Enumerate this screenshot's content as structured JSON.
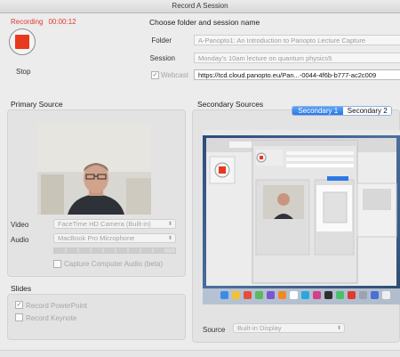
{
  "window": {
    "title": "Record A Session"
  },
  "recording": {
    "status": "Recording",
    "timer": "00:00:12",
    "stop_label": "Stop"
  },
  "session": {
    "heading": "Choose folder and session name",
    "folder_label": "Folder",
    "folder_value": "A-Panopto1: An Introduction to Panopto Lecture Capture",
    "session_label": "Session",
    "session_value": "Monday's 10am lecture on quantum physics5",
    "webcast_label": "Webcast",
    "webcast_url": "https://tcd.cloud.panopto.eu/Pan...-0044-4f6b-b777-ac2c009"
  },
  "primary": {
    "title": "Primary Source",
    "video_label": "Video",
    "video_value": "FaceTime HD Camera (Built-in)",
    "audio_label": "Audio",
    "audio_value": "MacBook Pro Microphone",
    "capture_audio_label": "Capture Computer Audio (beta)"
  },
  "slides": {
    "title": "Slides",
    "ppt_label": "Record PowerPoint",
    "keynote_label": "Record Keynote"
  },
  "secondary": {
    "title": "Secondary Sources",
    "tab1": "Secondary 1",
    "tab2": "Secondary 2",
    "source_label": "Source",
    "source_value": "Built-in Display"
  },
  "colors": {
    "recording_red": "#e03a2f",
    "stop_red": "#e8381e",
    "tab_blue": "#2b78e4"
  }
}
